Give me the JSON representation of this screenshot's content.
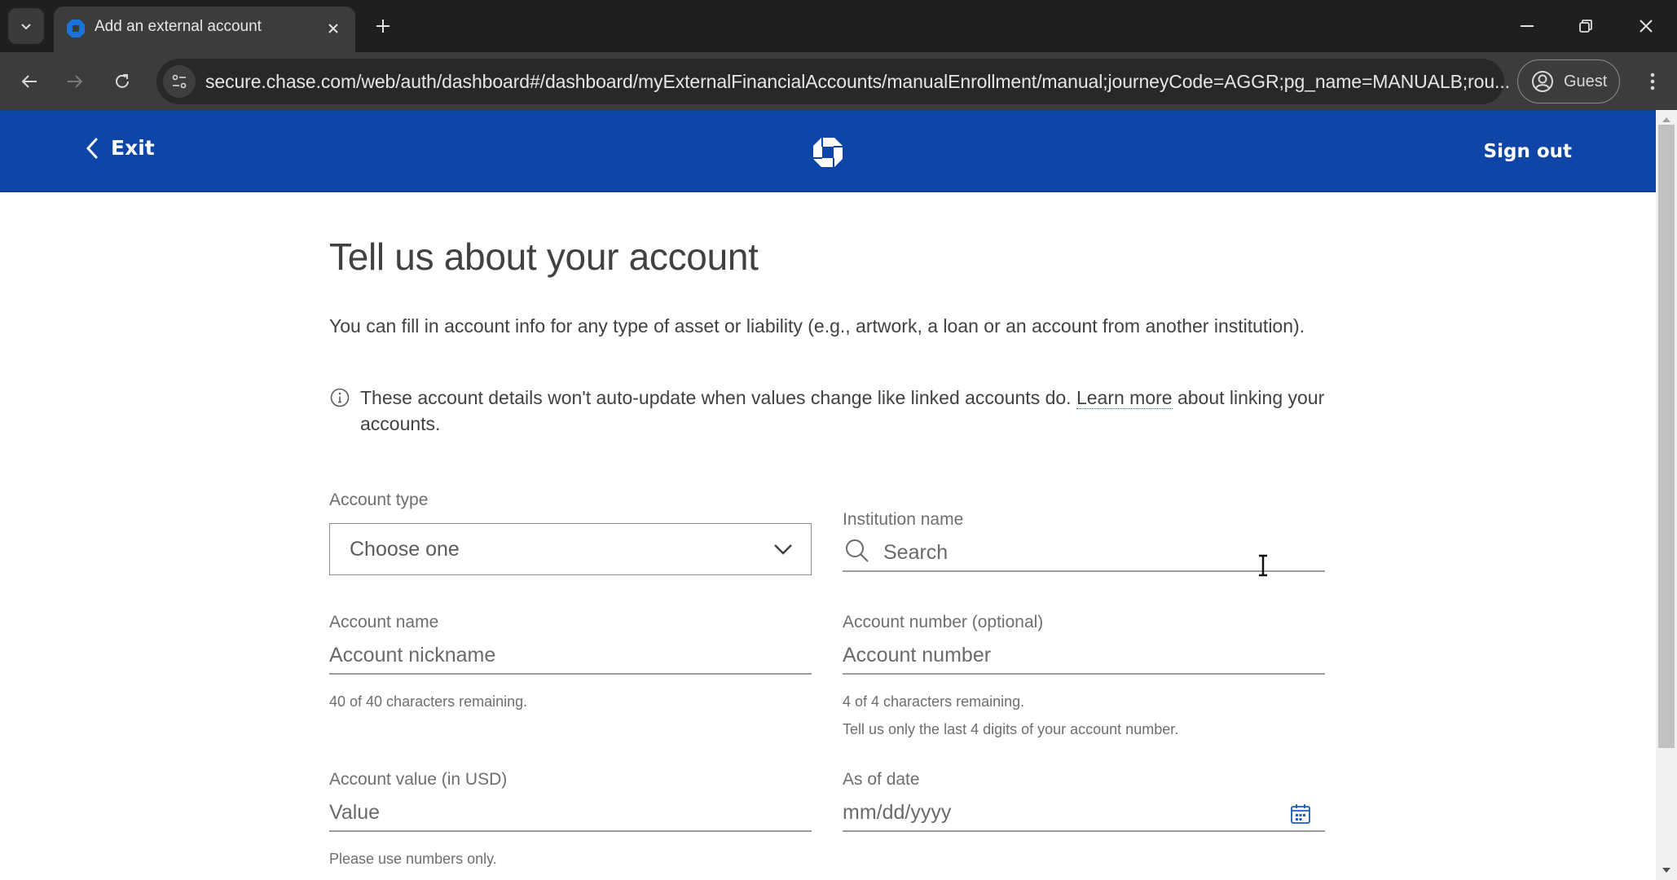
{
  "browser": {
    "tab_title": "Add an external account",
    "url": "secure.chase.com/web/auth/dashboard#/dashboard/myExternalFinancialAccounts/manualEnrollment/manual;journeyCode=AGGR;pg_name=MANUALB;rou...",
    "profile_label": "Guest"
  },
  "header": {
    "exit_label": "Exit",
    "sign_out_label": "Sign out",
    "brand_color": "#0f45a6"
  },
  "page": {
    "title": "Tell us about your account",
    "intro": "You can fill in account info for any type of asset or liability (e.g., artwork, a loan or an account from another institution).",
    "notice_before": "These account details won't auto-update when values change like linked accounts do. ",
    "notice_link": "Learn more",
    "notice_after": " about linking your accounts."
  },
  "form": {
    "account_type": {
      "label": "Account type",
      "selected": "Choose one"
    },
    "institution_name": {
      "label": "Institution name",
      "placeholder": "Search"
    },
    "account_name": {
      "label": "Account name",
      "placeholder": "Account nickname",
      "helper": "40 of 40 characters remaining."
    },
    "account_number": {
      "label": "Account number (optional)",
      "placeholder": "Account number",
      "helper": "4 of 4 characters remaining.",
      "hint": "Tell us only the last 4 digits of your account number."
    },
    "account_value": {
      "label": "Account value (in USD)",
      "placeholder": "Value",
      "helper": "Please use numbers only."
    },
    "as_of_date": {
      "label": "As of date",
      "placeholder": "mm/dd/yyyy"
    }
  }
}
